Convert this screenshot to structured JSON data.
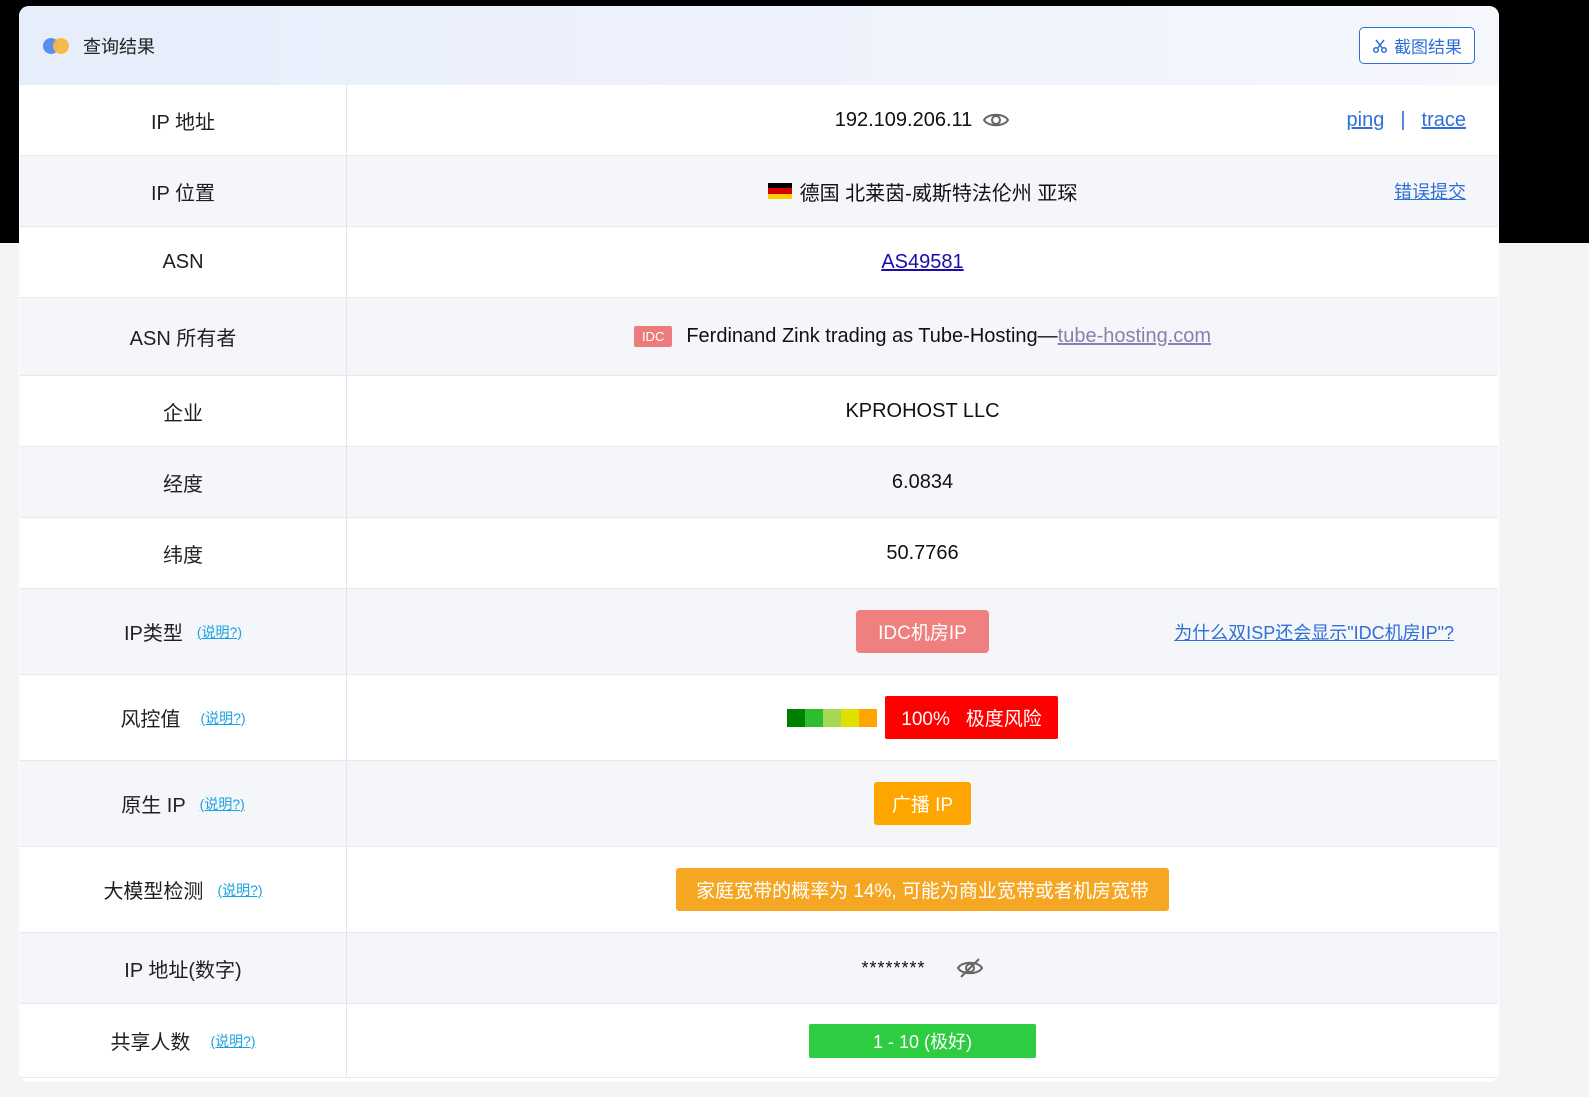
{
  "header": {
    "title": "查询结果",
    "screenshot_label": "截图结果"
  },
  "rows": {
    "ip": {
      "label": "IP 地址",
      "value": "192.109.206.11",
      "ping": "ping",
      "sep": "|",
      "trace": "trace"
    },
    "location": {
      "label": "IP 位置",
      "flag": "DE",
      "value": "德国 北莱茵-威斯特法伦州 亚琛",
      "report": "错误提交"
    },
    "asn": {
      "label": "ASN",
      "value": "AS49581"
    },
    "asn_owner": {
      "label": "ASN 所有者",
      "tag": "IDC",
      "value": "Ferdinand Zink trading as Tube-Hosting—",
      "site": "tube-hosting.com"
    },
    "company": {
      "label": "企业",
      "value": "KPROHOST LLC"
    },
    "longitude": {
      "label": "经度",
      "value": "6.0834"
    },
    "latitude": {
      "label": "纬度",
      "value": "50.7766"
    },
    "ip_type": {
      "label": "IP类型",
      "explain": "(说明?)",
      "badge": "IDC机房IP",
      "why": "为什么双ISP还会显示\"IDC机房IP\"?"
    },
    "risk": {
      "label": "风控值",
      "explain": "(说明?)",
      "badge": "100%   极度风险",
      "bar_colors": [
        "#008000",
        "#2ebd2e",
        "#a6d854",
        "#e0e000",
        "#ffa500"
      ]
    },
    "native": {
      "label": "原生 IP",
      "explain": "(说明?)",
      "badge": "广播 IP"
    },
    "llm": {
      "label": "大模型检测",
      "explain": "(说明?)",
      "badge": "家庭宽带的概率为 14%, 可能为商业宽带或者机房宽带"
    },
    "ip_numeric": {
      "label": "IP 地址(数字)",
      "value": "********"
    },
    "shared": {
      "label": "共享人数",
      "explain": "(说明?)",
      "badge": "1 - 10 (极好)"
    }
  },
  "colors": {
    "accent": "#2f6fd8",
    "idc": "#f08080",
    "risk": "#ff0000",
    "orange": "#ffa500",
    "green": "#2ecc40"
  },
  "icons": {
    "eye": "eye-icon",
    "eye_off": "eye-off-icon",
    "scissors": "scissors-icon"
  }
}
